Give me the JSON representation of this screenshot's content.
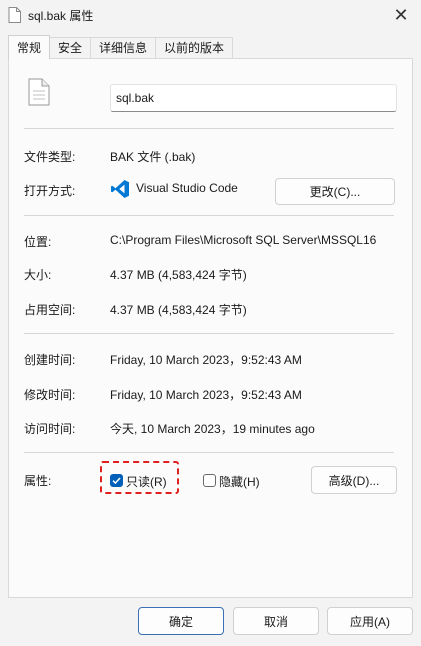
{
  "window": {
    "title": "sql.bak 属性",
    "close_symbol": "✕"
  },
  "tabs": [
    {
      "label": "常规",
      "active": true
    },
    {
      "label": "安全"
    },
    {
      "label": "详细信息"
    },
    {
      "label": "以前的版本"
    }
  ],
  "general": {
    "file_name": "sql.bak",
    "type_label": "文件类型:",
    "type_value": "BAK 文件 (.bak)",
    "opens_label": "打开方式:",
    "opens_app": "Visual Studio Code",
    "change_button": "更改(C)...",
    "location_label": "位置:",
    "location_value": "C:\\Program Files\\Microsoft SQL Server\\MSSQL16",
    "size_label": "大小:",
    "size_value": "4.37 MB (4,583,424 字节)",
    "disk_size_label": "占用空间:",
    "disk_size_value": "4.37 MB (4,583,424 字节)",
    "created_label": "创建时间:",
    "created_value": "Friday, 10 March 2023，9:52:43 AM",
    "modified_label": "修改时间:",
    "modified_value": "Friday, 10 March 2023，9:52:43 AM",
    "accessed_label": "访问时间:",
    "accessed_value": "今天, 10 March 2023，19 minutes ago",
    "attributes_label": "属性:",
    "readonly_label": "只读(R)",
    "readonly_checked": true,
    "hidden_label": "隐藏(H)",
    "hidden_checked": false,
    "advanced_button": "高级(D)..."
  },
  "footer": {
    "ok": "确定",
    "cancel": "取消",
    "apply": "应用(A)"
  },
  "colors": {
    "accent": "#005fb8",
    "highlight": "#e02020",
    "vscode_blue": "#0078d4"
  }
}
